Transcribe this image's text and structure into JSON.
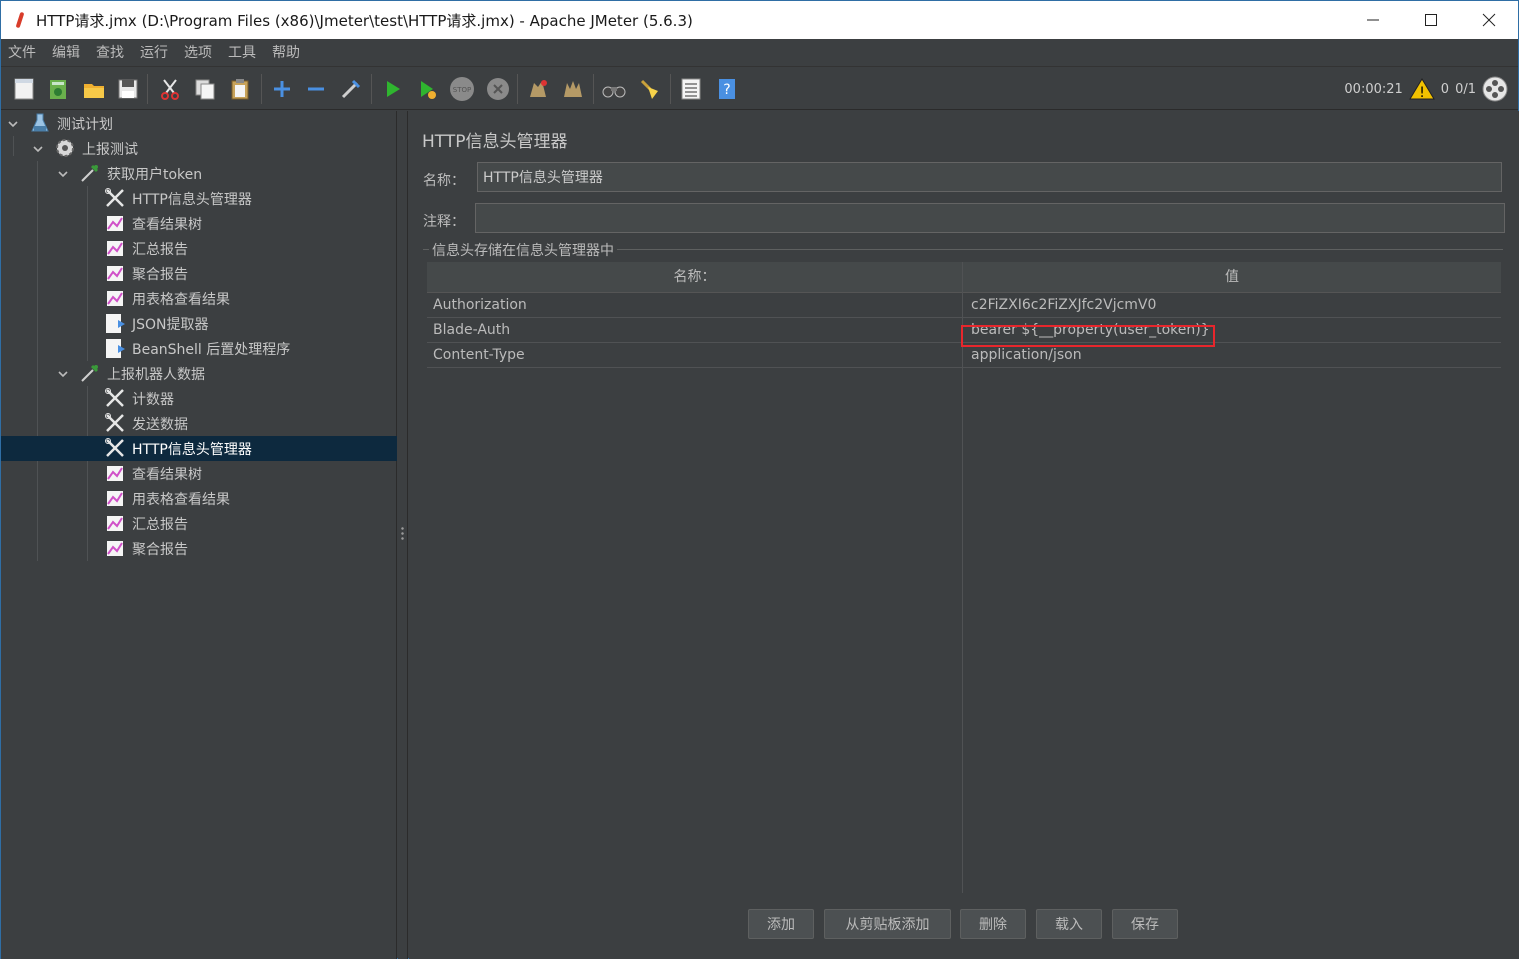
{
  "window": {
    "title": "HTTP请求.jmx (D:\\Program Files (x86)\\Jmeter\\test\\HTTP请求.jmx) - Apache JMeter (5.6.3)"
  },
  "menu": [
    "文件",
    "编辑",
    "查找",
    "运行",
    "选项",
    "工具",
    "帮助"
  ],
  "status": {
    "elapsed": "00:00:21",
    "warnings": "0",
    "threads": "0/1"
  },
  "tree": {
    "items": [
      {
        "label": "测试计划",
        "icon": "test-plan-icon"
      },
      {
        "label": "上报测试",
        "icon": "thread-group-icon"
      },
      {
        "label": "获取用户token",
        "icon": "sampler-icon"
      },
      {
        "label": "HTTP信息头管理器",
        "icon": "config-element-icon"
      },
      {
        "label": "查看结果树",
        "icon": "listener-icon"
      },
      {
        "label": "汇总报告",
        "icon": "listener-icon"
      },
      {
        "label": "聚合报告",
        "icon": "listener-icon"
      },
      {
        "label": "用表格查看结果",
        "icon": "listener-icon"
      },
      {
        "label": "JSON提取器",
        "icon": "postprocessor-icon"
      },
      {
        "label": "BeanShell 后置处理程序",
        "icon": "postprocessor-icon"
      },
      {
        "label": "上报机器人数据",
        "icon": "sampler-icon"
      },
      {
        "label": "计数器",
        "icon": "config-element-icon"
      },
      {
        "label": "发送数据",
        "icon": "config-element-icon"
      },
      {
        "label": "HTTP信息头管理器",
        "icon": "config-element-icon"
      },
      {
        "label": "查看结果树",
        "icon": "listener-icon"
      },
      {
        "label": "用表格查看结果",
        "icon": "listener-icon"
      },
      {
        "label": "汇总报告",
        "icon": "listener-icon"
      },
      {
        "label": "聚合报告",
        "icon": "listener-icon"
      }
    ]
  },
  "panel": {
    "title": "HTTP信息头管理器",
    "name_label": "名称：",
    "name_value": "HTTP信息头管理器",
    "comment_label": "注释：",
    "comment_value": "",
    "group_title": "信息头存储在信息头管理器中",
    "table": {
      "headers": [
        "名称：",
        "值"
      ],
      "rows": [
        {
          "name": "Authorization",
          "value": "c2FiZXI6c2FiZXJfc2VjcmV0"
        },
        {
          "name": "Blade-Auth",
          "value": "bearer ${__property(user_token)}"
        },
        {
          "name": "Content-Type",
          "value": "application/json"
        }
      ]
    },
    "buttons": {
      "add": "添加",
      "add_from_clipboard": "从剪贴板添加",
      "delete": "删除",
      "load": "载入",
      "save": "保存"
    }
  },
  "colors": {
    "background": "#3c3f41",
    "selection": "#0d293e",
    "highlight_border": "#e8262c"
  }
}
